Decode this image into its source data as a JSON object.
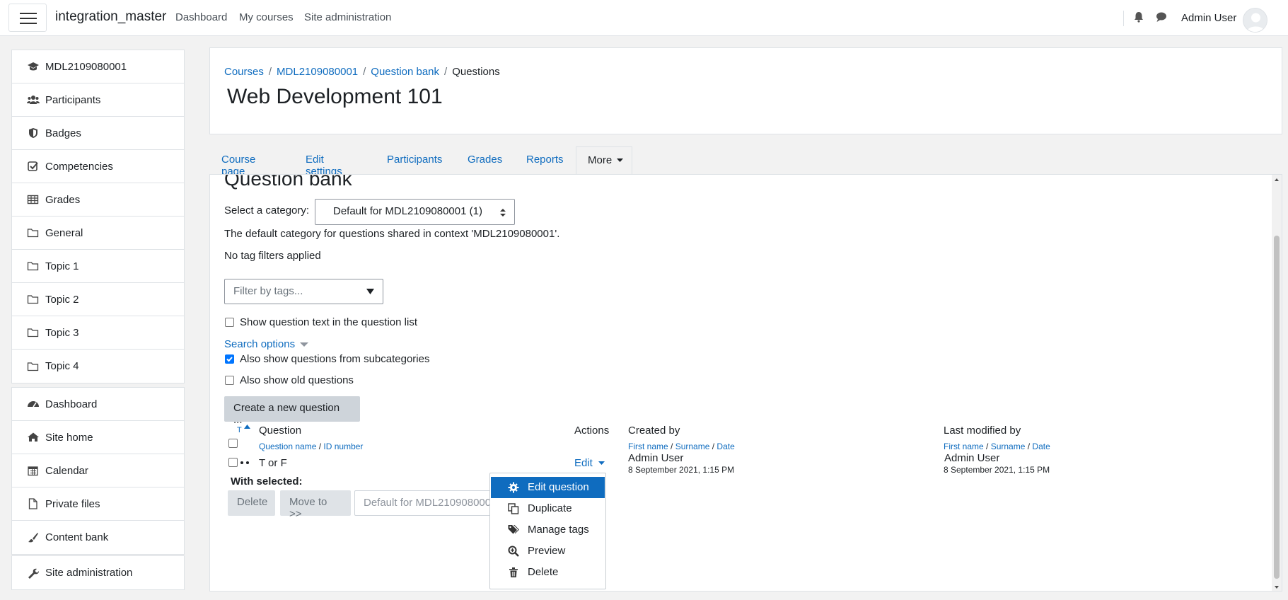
{
  "navbar": {
    "brand": "integration_master",
    "links": [
      "Dashboard",
      "My courses",
      "Site administration"
    ],
    "user_name": "Admin User"
  },
  "sidebar": {
    "course_items": [
      {
        "label": "MDL2109080001",
        "icon": "graduation-cap-icon"
      },
      {
        "label": "Participants",
        "icon": "users-icon"
      },
      {
        "label": "Badges",
        "icon": "shield-icon"
      },
      {
        "label": "Competencies",
        "icon": "check-square-icon"
      },
      {
        "label": "Grades",
        "icon": "table-icon"
      },
      {
        "label": "General",
        "icon": "folder-icon"
      },
      {
        "label": "Topic 1",
        "icon": "folder-icon"
      },
      {
        "label": "Topic 2",
        "icon": "folder-icon"
      },
      {
        "label": "Topic 3",
        "icon": "folder-icon"
      },
      {
        "label": "Topic 4",
        "icon": "folder-icon"
      }
    ],
    "site_items": [
      {
        "label": "Dashboard",
        "icon": "dashboard-icon"
      },
      {
        "label": "Site home",
        "icon": "home-icon"
      },
      {
        "label": "Calendar",
        "icon": "calendar-icon"
      },
      {
        "label": "Private files",
        "icon": "file-icon"
      },
      {
        "label": "Content bank",
        "icon": "paintbrush-icon"
      }
    ],
    "admin_item": {
      "label": "Site administration",
      "icon": "wrench-icon"
    }
  },
  "header": {
    "breadcrumb": [
      "Courses",
      "MDL2109080001",
      "Question bank",
      "Questions"
    ],
    "title": "Web Development 101"
  },
  "tabs": {
    "items": [
      "Course page",
      "Edit settings",
      "Participants",
      "Grades",
      "Reports"
    ],
    "more": "More"
  },
  "main": {
    "heading": "Question bank",
    "select_category_label": "Select a category:",
    "selected_category": "Default for MDL2109080001 (1)",
    "category_description": "The default category for questions shared in context 'MDL2109080001'.",
    "tag_filter_status": "No tag filters applied",
    "tag_filter_placeholder": "Filter by tags...",
    "show_question_text_label": "Show question text in the question list",
    "search_options_label": "Search options",
    "subcategories_label": "Also show questions from subcategories",
    "subcategories_checked": true,
    "old_questions_label": "Also show old questions",
    "create_button": "Create a new question ..."
  },
  "table": {
    "type_sort": "T",
    "question_header": "Question",
    "question_sub": [
      "Question name",
      "ID number"
    ],
    "actions_header": "Actions",
    "created_header": "Created by",
    "created_sub": [
      "First name",
      "Surname",
      "Date"
    ],
    "modified_header": "Last modified by",
    "modified_sub": [
      "First name",
      "Surname",
      "Date"
    ],
    "rows": [
      {
        "name": "T or F",
        "action": "Edit",
        "created_by": "Admin User",
        "created_date": "8 September 2021, 1:15 PM",
        "modified_by": "Admin User",
        "modified_date": "8 September 2021, 1:15 PM"
      }
    ]
  },
  "bulk": {
    "label": "With selected:",
    "delete": "Delete",
    "move": "Move to >>",
    "target_category": "Default for MDL2109080001 (1)"
  },
  "action_menu": {
    "items": [
      {
        "label": "Edit question",
        "icon": "gear-icon"
      },
      {
        "label": "Duplicate",
        "icon": "copy-icon"
      },
      {
        "label": "Manage tags",
        "icon": "tags-icon"
      },
      {
        "label": "Preview",
        "icon": "search-plus-icon"
      },
      {
        "label": "Delete",
        "icon": "trash-icon"
      }
    ]
  }
}
